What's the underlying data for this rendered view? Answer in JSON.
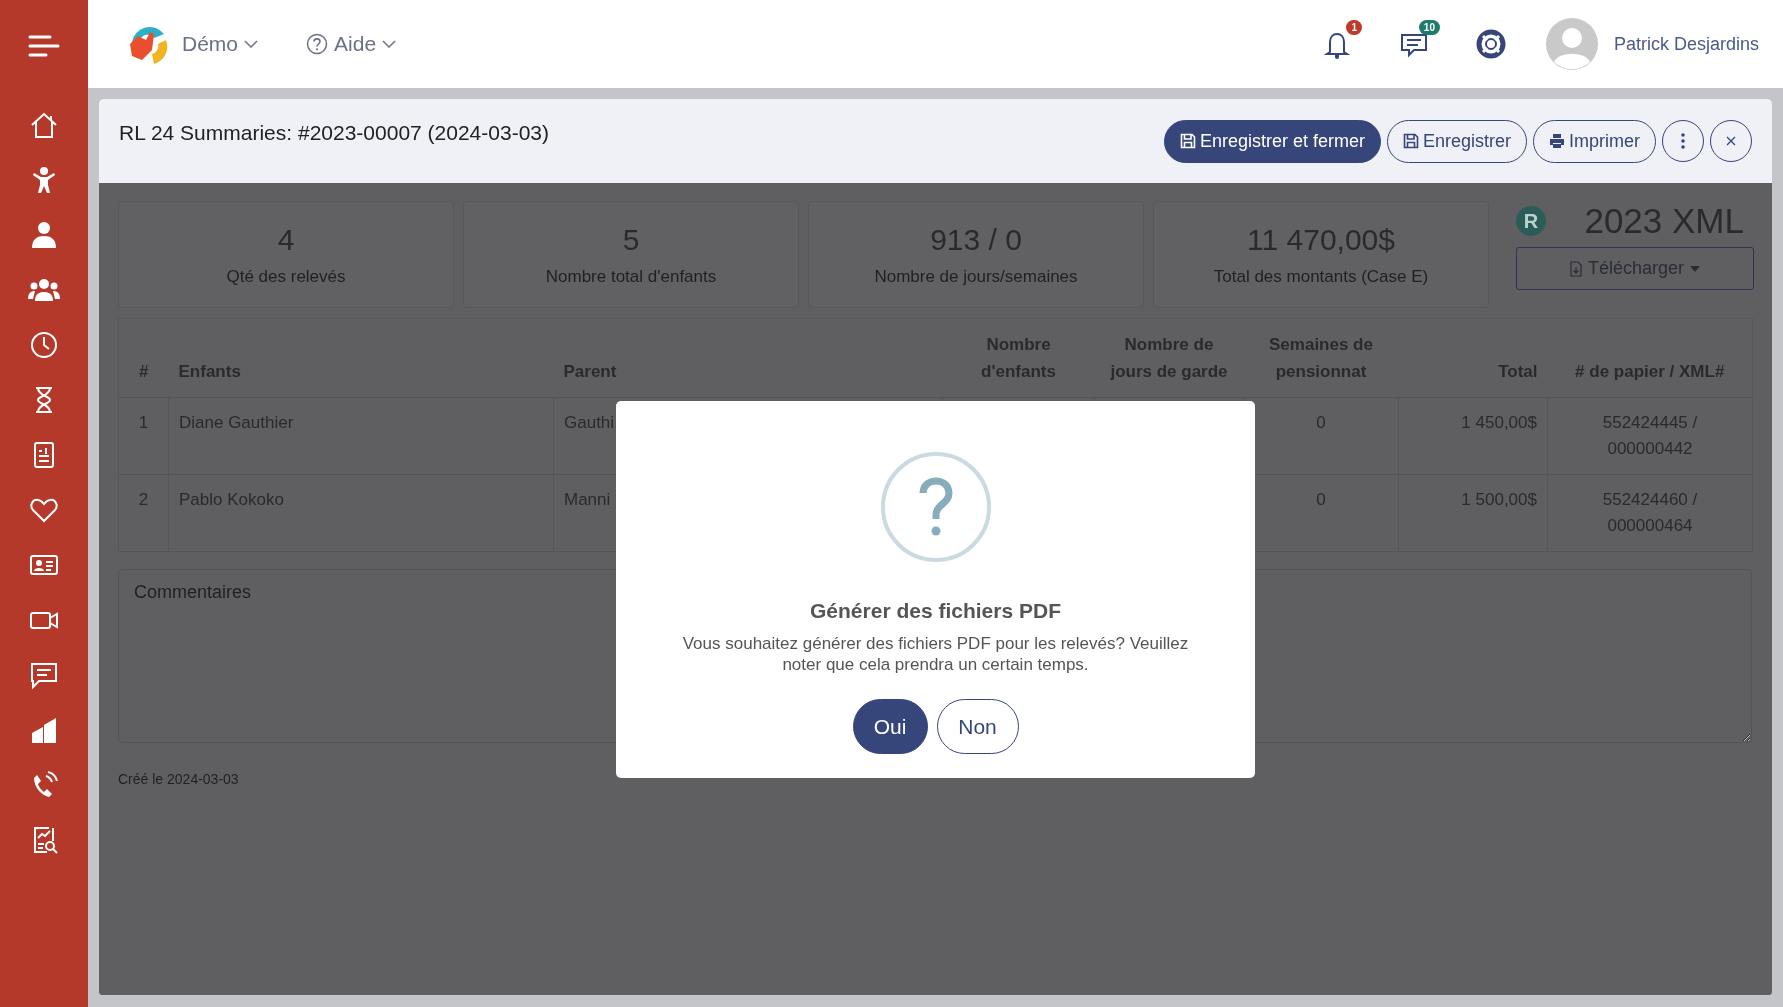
{
  "topbar": {
    "org": "Démo",
    "help": "Aide",
    "notifications": {
      "count": "1"
    },
    "messages": {
      "count": "10"
    },
    "user": "Patrick Desjardins"
  },
  "record": {
    "title": "RL 24 Summaries: #2023-00007 (2024-03-03)",
    "buttons": [
      {
        "label": "Enregistrer et fermer",
        "kind": "primary"
      },
      {
        "label": "Enregistrer",
        "kind": "outline"
      },
      {
        "label": "Imprimer",
        "kind": "outline"
      }
    ]
  },
  "stats": [
    {
      "value": "4",
      "label": "Qté des relevés"
    },
    {
      "value": "5",
      "label": "Nombre total d'enfants"
    },
    {
      "value": "913 / 0",
      "label": "Nombre de jours/semaines"
    },
    {
      "value": "11 470,00$",
      "label": "Total des montants (Case E)"
    }
  ],
  "xml": {
    "badge": "R",
    "title": "2023 XML",
    "download": "Télécharger"
  },
  "table": {
    "columns": [
      "#",
      "Enfants",
      "Parent",
      "Nombre d'enfants",
      "Nombre de jours de garde",
      "Semaines de pensionnat",
      "Total",
      "# de papier / XML#"
    ],
    "rows": [
      {
        "number": "1",
        "child": "Diane Gauthier",
        "parent": "Gauthi",
        "weeks": "0",
        "total": "1 450,00$",
        "paper": "552424445 / 000000442"
      },
      {
        "number": "2",
        "child": "Pablo Kokoko",
        "parent": "Manni",
        "weeks": "0",
        "total": "1 500,00$",
        "paper": "552424460 / 000000464"
      }
    ]
  },
  "comments": {
    "placeholder": "Commentaires"
  },
  "created": "Créé le 2024-03-03",
  "dialog": {
    "title": "Générer des fichiers PDF",
    "message": "Vous souhaitez générer des fichiers PDF pour les relevés? Veuillez noter que cela prendra un certain temps.",
    "buttons": [
      {
        "label": "Oui",
        "kind": "confirm"
      },
      {
        "label": "Non",
        "kind": "cancel"
      }
    ]
  }
}
